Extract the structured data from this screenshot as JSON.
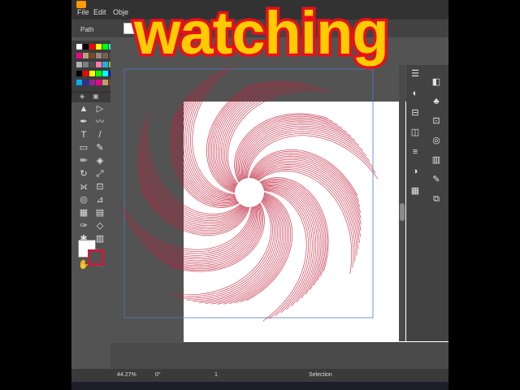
{
  "menu": {
    "file": "File",
    "edit": "Edit",
    "object": "Obje"
  },
  "options_bar": {
    "path_label": "Path"
  },
  "overlay_text": "watching",
  "status": {
    "zoom": "44.27%",
    "rotation": "0°",
    "artboard": "1",
    "tool": "Selection"
  },
  "colors": {
    "stroke": "#c0203a",
    "overlay_fill": "#ffcc00",
    "overlay_stroke": "#e8101a",
    "app_bg": "#535353"
  },
  "icons": [
    "selection-icon",
    "direct-selection-icon",
    "pen-icon",
    "curvature-icon",
    "type-icon",
    "line-icon",
    "rectangle-icon",
    "paintbrush-icon",
    "pencil-icon",
    "eraser-icon",
    "rotate-icon",
    "scale-icon",
    "width-icon",
    "free-transform-icon",
    "shape-builder-icon",
    "perspective-icon",
    "mesh-icon",
    "gradient-icon",
    "eyedropper-icon",
    "blend-icon",
    "symbol-sprayer-icon",
    "column-graph-icon",
    "artboard-icon",
    "slice-icon",
    "hand-icon",
    "zoom-icon"
  ]
}
